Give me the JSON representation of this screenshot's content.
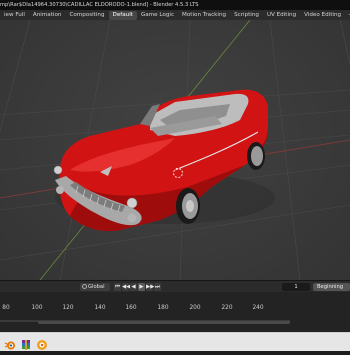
{
  "window": {
    "title": "mp\\Rar$DIa14964.30730\\CADILLAC ELDORODO-1.blend] - Blender 4.5.3 LTS"
  },
  "menu": {
    "tabs": [
      {
        "label": "iew Full"
      },
      {
        "label": "Animation"
      },
      {
        "label": "Compositing"
      },
      {
        "label": "Default",
        "active": true
      },
      {
        "label": "Game Logic"
      },
      {
        "label": "Motion Tracking"
      },
      {
        "label": "Scripting"
      },
      {
        "label": "UV Editing"
      },
      {
        "label": "Video Editing"
      }
    ],
    "add_tab": "+"
  },
  "viewport": {
    "object": "CADILLAC ELDORADO convertible",
    "body_color": "#d41414",
    "trim_color": "#a9a9a9"
  },
  "timeline": {
    "orientation": "Global",
    "playback": [
      "⏮",
      "◀◀",
      "◀",
      "▶",
      "▶▶",
      "⏭"
    ],
    "current_frame": "1",
    "start_label": "Beginning",
    "ticks": [
      "80",
      "100",
      "120",
      "140",
      "160",
      "180",
      "200",
      "220",
      "240"
    ]
  },
  "taskbar": {
    "icons": [
      "blender-icon",
      "winrar-icon",
      "files-icon"
    ]
  },
  "colors": {
    "accent": "#4772b3",
    "menu_bg": "#2b2b2b",
    "viewport_bg": "#3d3d3d"
  }
}
